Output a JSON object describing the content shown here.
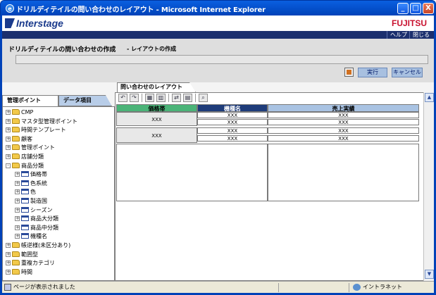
{
  "window": {
    "title": "ドリルディテイルの問い合わせのレイアウト - Microsoft Internet Explorer",
    "minimize": "_",
    "maximize": "□",
    "close": "X"
  },
  "brand": {
    "product": "Interstage",
    "vendor": "FUJITSU",
    "help_label": "ヘルプ",
    "close_label": "閉じる"
  },
  "header": {
    "page_title": "ドリルディテイルの問い合わせの作成",
    "subtitle": "- レイアウトの作成",
    "run_label": "実行",
    "cancel_label": "キャンセル"
  },
  "left_panel": {
    "tab_active": "管理ポイント",
    "tab_inactive": "データ項目",
    "tree": [
      {
        "label": "CMP",
        "type": "folder",
        "level": 0,
        "exp": "+"
      },
      {
        "label": "マスタ型管理ポイント",
        "type": "folder",
        "level": 0,
        "exp": "+"
      },
      {
        "label": "時間テンプレート",
        "type": "folder",
        "level": 0,
        "exp": "+"
      },
      {
        "label": "顧客",
        "type": "folder",
        "level": 0,
        "exp": "+"
      },
      {
        "label": "管理ポイント",
        "type": "folder",
        "level": 0,
        "exp": "+"
      },
      {
        "label": "店舗分類",
        "type": "folder",
        "level": 0,
        "exp": "+"
      },
      {
        "label": "商品分類",
        "type": "folder",
        "level": 0,
        "exp": "-"
      },
      {
        "label": "価格帯",
        "type": "field",
        "level": 1,
        "exp": "+"
      },
      {
        "label": "色系統",
        "type": "field",
        "level": 1,
        "exp": "+"
      },
      {
        "label": "色",
        "type": "field",
        "level": 1,
        "exp": "+"
      },
      {
        "label": "製造国",
        "type": "field",
        "level": 1,
        "exp": "+"
      },
      {
        "label": "シーズン",
        "type": "field",
        "level": 1,
        "exp": "+"
      },
      {
        "label": "商品大分類",
        "type": "field",
        "level": 1,
        "exp": "+"
      },
      {
        "label": "商品中分類",
        "type": "field",
        "level": 1,
        "exp": "+"
      },
      {
        "label": "機種名",
        "type": "field",
        "level": 1,
        "exp": "+"
      },
      {
        "label": "帳逆様(未区分あり)",
        "type": "folder",
        "level": 0,
        "exp": "+"
      },
      {
        "label": "範囲型",
        "type": "folder",
        "level": 0,
        "exp": "+"
      },
      {
        "label": "重複カテゴリ",
        "type": "folder",
        "level": 0,
        "exp": "+"
      },
      {
        "label": "時間",
        "type": "folder",
        "level": 0,
        "exp": "+"
      }
    ]
  },
  "right_panel": {
    "tab": "問い合わせのレイアウト",
    "columns": [
      "価格帯",
      "機種名",
      "売上実績"
    ],
    "placeholder": "XXX"
  },
  "status": {
    "left": "ページが表示されました",
    "zone": "イントラネット"
  }
}
